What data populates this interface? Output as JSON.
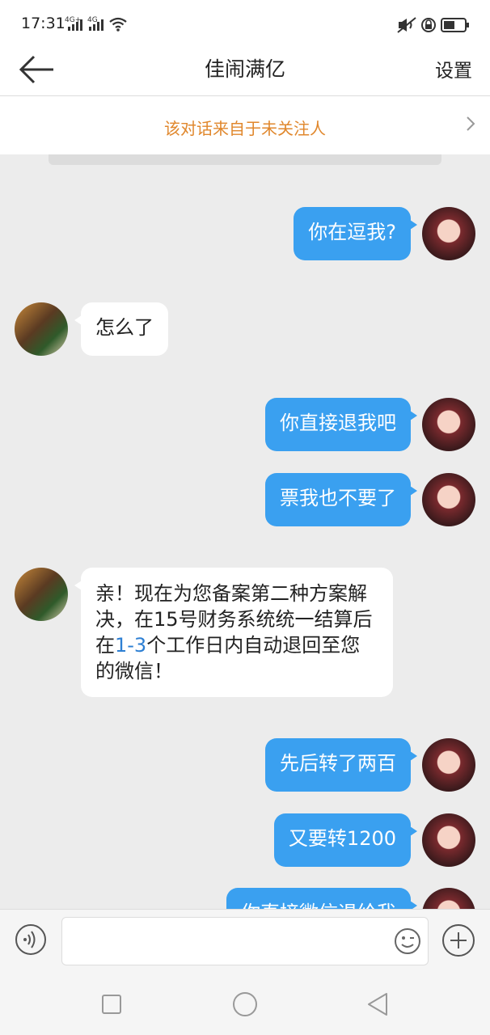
{
  "status_bar": {
    "time": "17:31",
    "signal1": "4G+",
    "signal2": "4G",
    "icons": [
      "wifi-icon",
      "mute-icon",
      "alarm-icon",
      "battery-icon"
    ]
  },
  "header": {
    "title": "佳闹满亿",
    "settings_label": "设置"
  },
  "notice": {
    "text": "该对话来自于未关注人"
  },
  "messages": [
    {
      "side": "right",
      "text": "你在逗我?"
    },
    {
      "side": "left",
      "text": "怎么了"
    },
    {
      "side": "right",
      "text": "你直接退我吧"
    },
    {
      "side": "right",
      "text": "票我也不要了"
    },
    {
      "side": "left",
      "text_before": "亲！现在为您备案第二种方案解决，在15号财务系统统一结算后在",
      "link": "1-3",
      "text_after": "个工作日内自动退回至您的微信！"
    },
    {
      "side": "right",
      "text": "先后转了两百"
    },
    {
      "side": "right",
      "text": "又要转1200"
    },
    {
      "side": "right",
      "text": "你直接微信退给我"
    }
  ],
  "input": {
    "placeholder": ""
  },
  "colors": {
    "outgoing_bubble": "#3aa0f0",
    "incoming_bubble": "#ffffff",
    "notice_text": "#e0872c",
    "link": "#2d7fd3",
    "chat_background": "#ececec"
  }
}
